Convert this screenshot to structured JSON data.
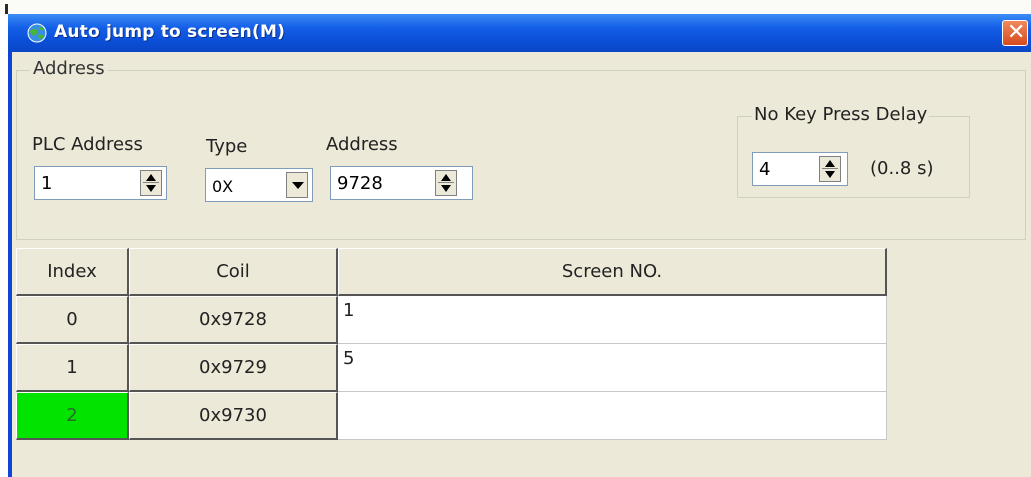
{
  "window": {
    "title": "Auto jump to screen(M)",
    "icon": "globe-app-icon",
    "close_icon": "close-icon"
  },
  "address_group": {
    "legend": "Address",
    "plc_address": {
      "label": "PLC Address",
      "value": "1"
    },
    "type": {
      "label": "Type",
      "value": "0X"
    },
    "address": {
      "label": "Address",
      "value": "9728"
    },
    "delay": {
      "legend": "No Key Press Delay",
      "value": "4",
      "unit": "(0..8 s)"
    }
  },
  "table": {
    "columns": [
      "Index",
      "Coil",
      "Screen NO."
    ],
    "rows": [
      {
        "index": "0",
        "coil": "0x9728",
        "screen": "1"
      },
      {
        "index": "1",
        "coil": "0x9729",
        "screen": "5"
      },
      {
        "index": "2",
        "coil": "0x9730",
        "screen": ""
      }
    ],
    "selected_row_color": "#00e400"
  },
  "colors": {
    "titlebar": "#0b4fd8",
    "client": "#ece9d8"
  }
}
